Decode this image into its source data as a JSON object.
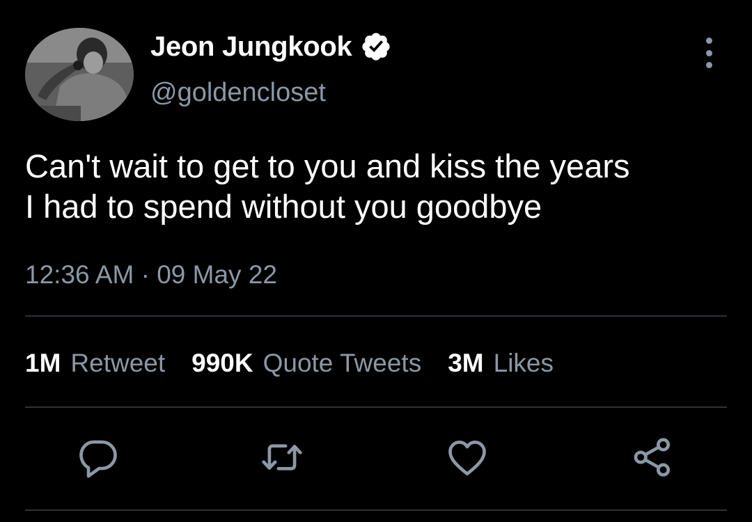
{
  "tweet": {
    "display_name": "Jeon Jungkook",
    "handle": "@goldencloset",
    "text_lines": [
      "Can't wait to get to you and kiss the years",
      "I had to spend without you goodbye"
    ],
    "timestamp": "12:36 AM · 09 May 22"
  },
  "stats": [
    {
      "count": "1M",
      "label": "Retweet"
    },
    {
      "count": "990K",
      "label": "Quote Tweets"
    },
    {
      "count": "3M",
      "label": "Likes"
    }
  ],
  "icons": {
    "verified": "verified-badge-icon",
    "more": "more-vertical-icon",
    "reply": "reply-icon",
    "retweet": "retweet-icon",
    "like": "heart-icon",
    "share": "share-icon"
  },
  "colors": {
    "background": "#000000",
    "text_primary": "#ffffff",
    "text_secondary": "#8b98a5",
    "divider": "#2f3336"
  }
}
